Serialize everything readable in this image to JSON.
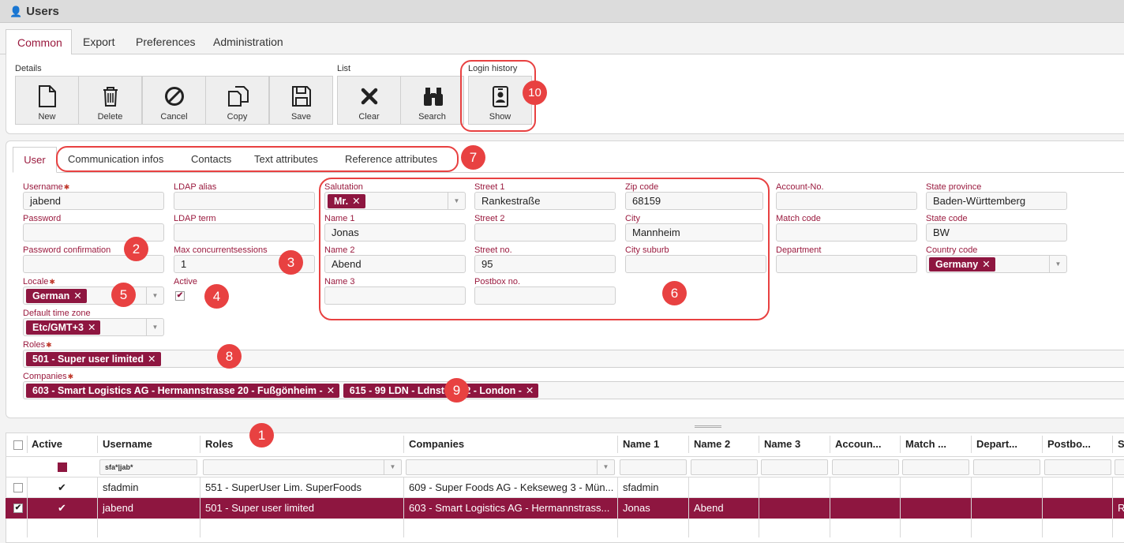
{
  "window": {
    "title": "Users",
    "icon": "user-icon"
  },
  "main_tabs": [
    "Common",
    "Export",
    "Preferences",
    "Administration"
  ],
  "toolbar": {
    "details_label": "Details",
    "list_label": "List",
    "login_history_label": "Login history",
    "buttons": {
      "new": "New",
      "delete": "Delete",
      "cancel": "Cancel",
      "copy": "Copy",
      "save": "Save",
      "clear": "Clear",
      "search": "Search",
      "show": "Show"
    }
  },
  "sub_tabs": [
    "User",
    "Communication infos",
    "Contacts",
    "Text attributes",
    "Reference attributes"
  ],
  "form": {
    "username": {
      "label": "Username",
      "value": "jabend"
    },
    "password": {
      "label": "Password",
      "value": ""
    },
    "password_confirmation": {
      "label": "Password confirmation",
      "value": ""
    },
    "locale": {
      "label": "Locale",
      "value": "German"
    },
    "default_time_zone": {
      "label": "Default time zone",
      "value": "Etc/GMT+3"
    },
    "ldap_alias": {
      "label": "LDAP alias",
      "value": ""
    },
    "ldap_term": {
      "label": "LDAP term",
      "value": ""
    },
    "max_sessions": {
      "label": "Max concurrentsessions",
      "value": "1"
    },
    "active": {
      "label": "Active",
      "checked": true
    },
    "salutation": {
      "label": "Salutation",
      "value": "Mr."
    },
    "name1": {
      "label": "Name 1",
      "value": "Jonas"
    },
    "name2": {
      "label": "Name 2",
      "value": "Abend"
    },
    "name3": {
      "label": "Name 3",
      "value": ""
    },
    "street1": {
      "label": "Street 1",
      "value": "Rankestraße"
    },
    "street2": {
      "label": "Street 2",
      "value": ""
    },
    "street_no": {
      "label": "Street no.",
      "value": "95"
    },
    "postbox": {
      "label": "Postbox no.",
      "value": ""
    },
    "zip": {
      "label": "Zip code",
      "value": "68159"
    },
    "city": {
      "label": "City",
      "value": "Mannheim"
    },
    "city_suburb": {
      "label": "City suburb",
      "value": ""
    },
    "account_no": {
      "label": "Account-No.",
      "value": ""
    },
    "match_code": {
      "label": "Match code",
      "value": ""
    },
    "department": {
      "label": "Department",
      "value": ""
    },
    "state_province": {
      "label": "State province",
      "value": "Baden-Württemberg"
    },
    "state_code": {
      "label": "State code",
      "value": "BW"
    },
    "country_code": {
      "label": "Country code",
      "value": "Germany"
    },
    "roles": {
      "label": "Roles",
      "values": [
        "501 - Super user limited"
      ]
    },
    "companies": {
      "label": "Companies",
      "values": [
        "603 - Smart Logistics AG - Hermannstrasse 20 - Fußgönheim -",
        "615 - 99 LDN - Ldnstreet 2 - London -"
      ]
    }
  },
  "badges": [
    "1",
    "2",
    "3",
    "4",
    "5",
    "6",
    "7",
    "8",
    "9",
    "10"
  ],
  "grid": {
    "headers": [
      "Active",
      "Username",
      "Roles",
      "Companies",
      "Name 1",
      "Name 2",
      "Name 3",
      "Accoun...",
      "Match ...",
      "Depart...",
      "Postbo...",
      "S"
    ],
    "filter_username": "sfa*|jab*",
    "rows": [
      {
        "selected": false,
        "active": "✔",
        "username": "sfadmin",
        "roles": "551 - SuperUser Lim. SuperFoods",
        "companies": "609 - Super Foods AG - Kekseweg 3 - Mün...",
        "name1": "sfadmin",
        "name2": "",
        "s": ""
      },
      {
        "selected": true,
        "active": "✔",
        "username": "jabend",
        "roles": "501 - Super user limited",
        "companies": "603 - Smart Logistics AG - Hermannstrass...",
        "name1": "Jonas",
        "name2": "Abend",
        "s": "R"
      }
    ]
  },
  "colors": {
    "accent": "#8e1640",
    "badge": "#e84141"
  }
}
